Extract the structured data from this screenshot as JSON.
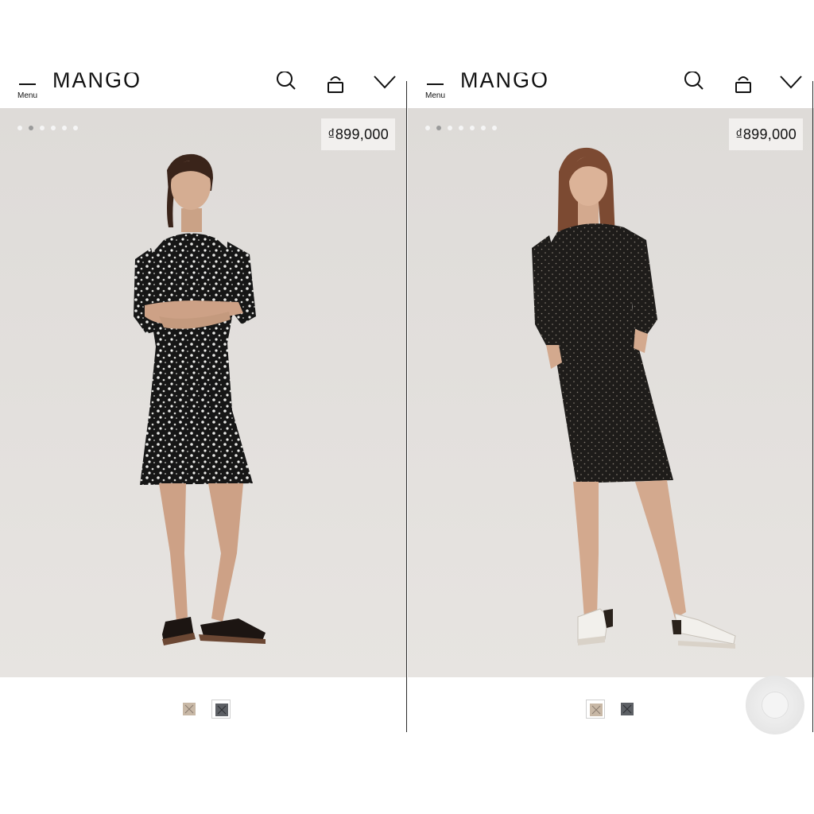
{
  "panels": [
    {
      "header": {
        "menu_label": "Menu",
        "logo": "MANGO"
      },
      "icons": [
        "search-icon",
        "bag-icon",
        "wishlist-heart-icon"
      ],
      "gallery": {
        "image_count": 6,
        "active_index": 1
      },
      "price": "₫899,000",
      "product": {
        "dress_pattern": "floral print",
        "dress_color": "#1a1a1a",
        "footwear": "black thong sandals"
      },
      "swatches": [
        {
          "color": "#c8b8a6",
          "selected": false
        },
        {
          "color": "#5d6065",
          "selected": true
        }
      ]
    },
    {
      "header": {
        "menu_label": "Menu",
        "logo": "MANGO"
      },
      "icons": [
        "search-icon",
        "bag-icon",
        "wishlist-heart-icon"
      ],
      "gallery": {
        "image_count": 7,
        "active_index": 1
      },
      "price": "₫899,000",
      "product": {
        "dress_pattern": "polka dot",
        "dress_color": "#1e1c1a",
        "footwear": "white strappy mules"
      },
      "swatches": [
        {
          "color": "#c8b8a6",
          "selected": true
        },
        {
          "color": "#5d6065",
          "selected": false
        }
      ]
    }
  ],
  "floating_button": {
    "icon": "circle-button-icon"
  }
}
